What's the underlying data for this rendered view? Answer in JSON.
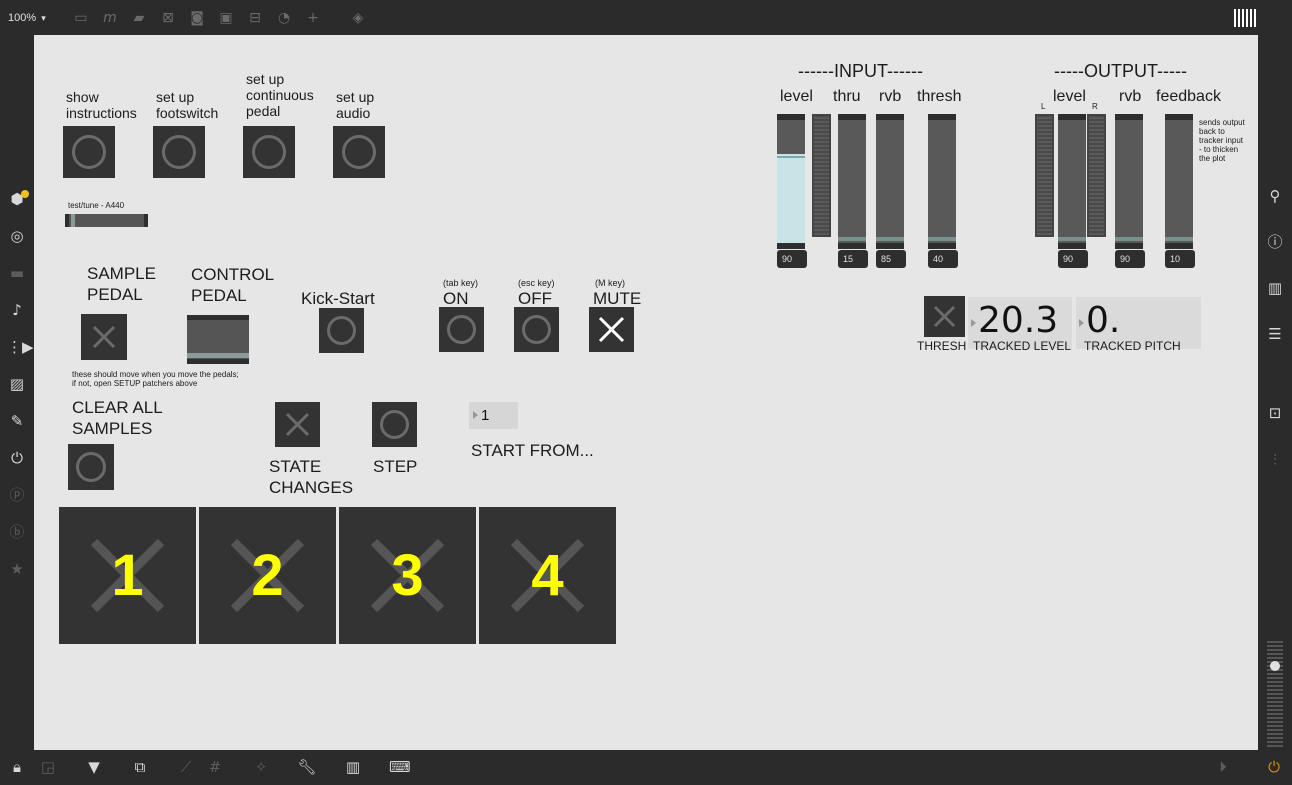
{
  "topbar": {
    "zoom": "100%",
    "zoom_caret": "▾",
    "icons": [
      "presentation-icon",
      "message-icon",
      "comment-icon",
      "toggle-icon",
      "button-icon",
      "slider-icon",
      "fader-icon",
      "dial-icon",
      "add-icon",
      "paint-bucket-icon"
    ],
    "grid_icon": "grid-icon"
  },
  "leftbar": {
    "icons": [
      "package-icon",
      "target-icon",
      "video-icon",
      "music-icon",
      "sequence-icon",
      "image-icon",
      "paperclip-icon",
      "plug-icon",
      "p-icon",
      "b-icon",
      "star-icon"
    ]
  },
  "rightbar": {
    "icons": [
      "search-icon",
      "info-icon",
      "book-icon",
      "list-icon",
      "camera-icon",
      "mixer-icon"
    ]
  },
  "bottombar": {
    "icons": [
      "lock-icon",
      "present-icon",
      "comment-icon",
      "window-icon",
      "snap-icon",
      "grid-icon",
      "wand-icon",
      "wrench-icon",
      "piano-icon",
      "keyboard-icon"
    ],
    "right_icons": [
      "transport-icon",
      "power-icon"
    ]
  },
  "setup": {
    "show_instructions": "show\ninstructions",
    "set_up_footswitch": "set up\nfootswitch",
    "set_up_pedal": "set up\ncontinuous\npedal",
    "set_up_audio": "set up\naudio",
    "test_tune": "test/tune - A440"
  },
  "pedals": {
    "sample_pedal": "SAMPLE\nPEDAL",
    "control_pedal": "CONTROL\nPEDAL",
    "kick_start": "Kick-Start",
    "note": "these should move when you move the pedals;\nif not, open SETUP patchers above",
    "on_hint": "(tab key)",
    "on": "ON",
    "off_hint": "(esc key)",
    "off": "OFF",
    "mute_hint": "(M key)",
    "mute": "MUTE"
  },
  "controls": {
    "clear_all": "CLEAR ALL\nSAMPLES",
    "state_changes": "STATE\nCHANGES",
    "step": "STEP",
    "start_from_value": "1",
    "start_from": "START FROM..."
  },
  "samples": [
    "1",
    "2",
    "3",
    "4"
  ],
  "input": {
    "header": "------INPUT------",
    "cols": {
      "level": "level",
      "thru": "thru",
      "rvb": "rvb",
      "thresh": "thresh"
    },
    "values": {
      "level": "90",
      "thru": "15",
      "rvb": "85",
      "thresh": "40"
    }
  },
  "output": {
    "header": "-----OUTPUT-----",
    "cols": {
      "level": "level",
      "rvb": "rvb",
      "feedback": "feedback"
    },
    "l": "L",
    "r": "R",
    "values": {
      "level": "90",
      "rvb": "90",
      "feedback": "10"
    },
    "note": "sends output\nback to\ntracker input\n- to thicken\nthe plot"
  },
  "tracker": {
    "thresh": "THRESH",
    "tracked_level_label": "TRACKED LEVEL",
    "tracked_level": "20.3",
    "tracked_pitch_label": "TRACKED PITCH",
    "tracked_pitch": "0."
  },
  "colors": {
    "accent_yellow": "#ffff00",
    "mute_active": "#ffffff",
    "level_fill": "#c8e4e6",
    "power": "#e08a1e"
  }
}
